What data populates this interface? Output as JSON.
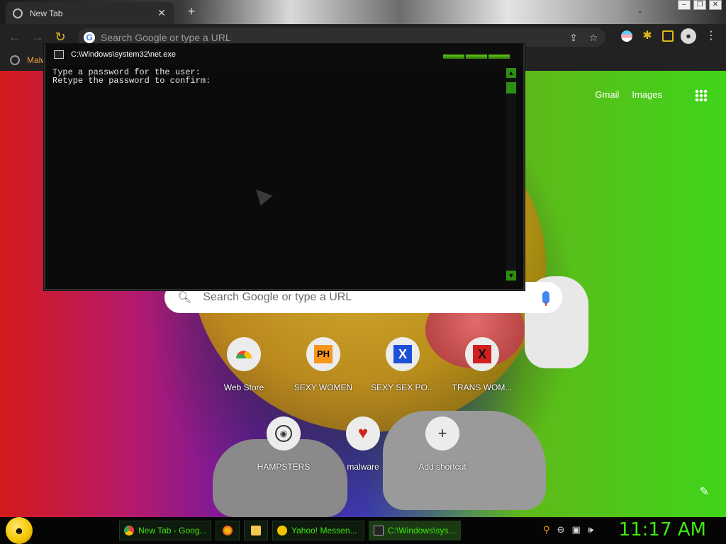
{
  "browser": {
    "tab_title": "New Tab",
    "tab_close": "✕",
    "new_tab": "+",
    "window_controls": [
      "–",
      "❐",
      "✕"
    ],
    "tab_search": "⌄",
    "address_placeholder": "Search Google or type a URL",
    "icons": [
      "back-arrow-icon",
      "forward-arrow-icon",
      "reload-icon",
      "share-icon",
      "star-icon",
      "trans-flag-extension-icon",
      "puzzle-extension-icon",
      "side-panel-icon",
      "profile-icon",
      "menu-kebab-icon"
    ],
    "bookmarks": [
      "Malw"
    ]
  },
  "ntp": {
    "gmail": "Gmail",
    "images": "Images",
    "search_placeholder": "Search Google or type a URL",
    "shortcuts": [
      {
        "label": "Web Store",
        "icon": "chrome-web-store-icon"
      },
      {
        "label": "SEXY WOMEN",
        "icon": "ph-icon",
        "glyph": "PH"
      },
      {
        "label": "SEXY SEX PO...",
        "icon": "x-blue-icon",
        "glyph": "X"
      },
      {
        "label": "TRANS WOM...",
        "icon": "x-red-icon",
        "glyph": "X"
      },
      {
        "label": "HAMPSTERS",
        "icon": "hamster-icon",
        "glyph": "🐹"
      },
      {
        "label": "malware",
        "icon": "heart-icon",
        "glyph": "♥"
      },
      {
        "label": "Add shortcut",
        "icon": "plus-icon",
        "glyph": "+"
      }
    ]
  },
  "console": {
    "title": "C:\\Windows\\system32\\net.exe",
    "lines": [
      "Type a password for the user:",
      "Retype the password to confirm:"
    ]
  },
  "taskbar": {
    "tasks": [
      {
        "label": "New Tab - Goog...",
        "icon": "chrome-icon"
      },
      {
        "label": "",
        "icon": "firefox-icon"
      },
      {
        "label": "",
        "icon": "folder-icon"
      },
      {
        "label": "Yahoo! Messen...",
        "icon": "yahoo-messenger-icon"
      },
      {
        "label": "C:\\Windows\\sys...",
        "icon": "console-icon"
      }
    ],
    "clock": "11:17 AM"
  },
  "colors": {
    "console_green": "#3ee80f",
    "accent_orange": "#e8a33c"
  }
}
